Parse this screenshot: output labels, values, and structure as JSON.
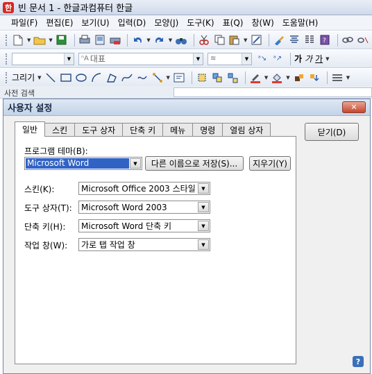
{
  "app": {
    "title": "빈 문서 1 - 한글과컴퓨터 한글",
    "logo": "한"
  },
  "menu": [
    "파일(F)",
    "편집(E)",
    "보기(U)",
    "입력(D)",
    "모양(J)",
    "도구(K)",
    "표(Q)",
    "창(W)",
    "도움말(H)"
  ],
  "toolbar2": {
    "style_label": "대표",
    "bold": "가",
    "italic": "가",
    "underline": "가"
  },
  "toolbar3": {
    "draw_label": "그리기"
  },
  "side_pane": {
    "title": "사전 검색"
  },
  "dialog": {
    "title": "사용자 설정",
    "close_glyph": "✕",
    "tabs": [
      "일반",
      "스킨",
      "도구 상자",
      "단축 키",
      "메뉴",
      "명령",
      "열림 상자"
    ],
    "close_button": "닫기(D)",
    "help_glyph": "?",
    "theme": {
      "label": "프로그램 테마(B):",
      "value": "Microsoft Word",
      "save_as_button": "다른 이름으로 저장(S)...",
      "delete_button": "지우기(Y)"
    },
    "fields": [
      {
        "label": "스킨(K):",
        "value": "Microsoft Office 2003 스타일"
      },
      {
        "label": "도구 상자(T):",
        "value": "Microsoft Word 2003"
      },
      {
        "label": "단축 키(H):",
        "value": "Microsoft Word 단축 키"
      },
      {
        "label": "작업 창(W):",
        "value": "가로 탭 작업 창"
      }
    ]
  }
}
